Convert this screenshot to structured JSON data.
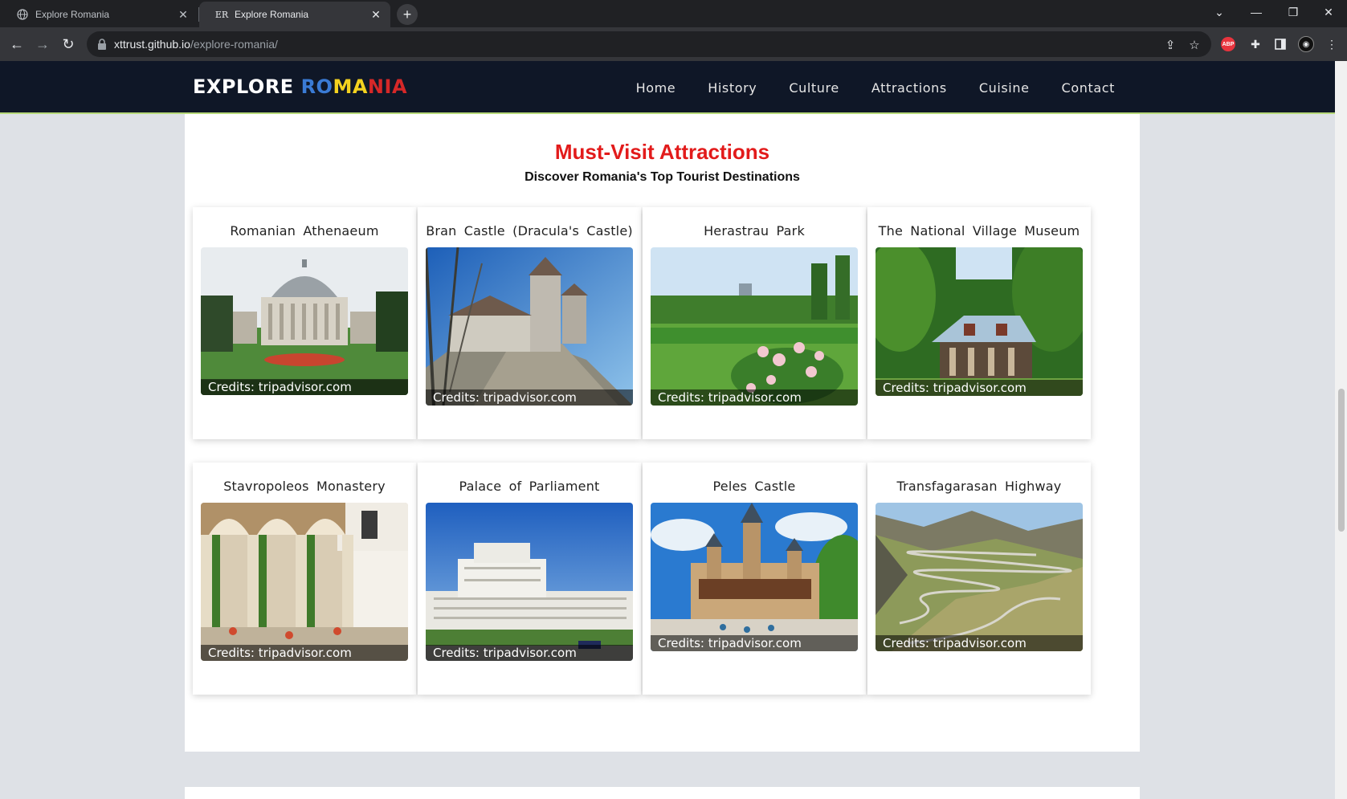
{
  "browser": {
    "tabs": [
      {
        "title": "Explore Romania",
        "favicon": "globe-icon",
        "active": false
      },
      {
        "title": "Explore Romania",
        "favicon": "ER",
        "active": true
      }
    ],
    "url_host": "xttrust.github.io",
    "url_path": "/explore-romania/",
    "extensions": [
      "share-icon",
      "star-icon",
      "abp-icon",
      "puzzle-icon",
      "sidepanel-icon",
      "profile-icon",
      "menu-icon"
    ],
    "abp_label": "ABP"
  },
  "site": {
    "logo": {
      "part1": "EXPLORE ",
      "part2": "RO",
      "part3": "MA",
      "part4": "NIA"
    },
    "colors": {
      "nav_bg": "#0f1727",
      "title_red": "#e21b1b",
      "logo_blue": "#3a7bd5",
      "logo_yellow": "#f4d21f",
      "logo_red": "#d62828"
    },
    "menu": [
      "Home",
      "History",
      "Culture",
      "Attractions",
      "Cuisine",
      "Contact"
    ]
  },
  "section": {
    "title": "Must-Visit Attractions",
    "subtitle": "Discover Romania's Top Tourist Destinations"
  },
  "attractions": [
    {
      "name": "Romanian Athenaeum",
      "credit": "Credits: tripadvisor.com"
    },
    {
      "name": "Bran Castle (Dracula's Castle)",
      "credit": "Credits: tripadvisor.com"
    },
    {
      "name": "Herastrau Park",
      "credit": "Credits: tripadvisor.com"
    },
    {
      "name": "The National Village Museum",
      "credit": "Credits: tripadvisor.com"
    },
    {
      "name": "Stavropoleos Monastery",
      "credit": "Credits: tripadvisor.com"
    },
    {
      "name": "Palace of Parliament",
      "credit": "Credits: tripadvisor.com"
    },
    {
      "name": "Peles Castle",
      "credit": "Credits: tripadvisor.com"
    },
    {
      "name": "Transfagarasan Highway",
      "credit": "Credits: tripadvisor.com"
    }
  ]
}
